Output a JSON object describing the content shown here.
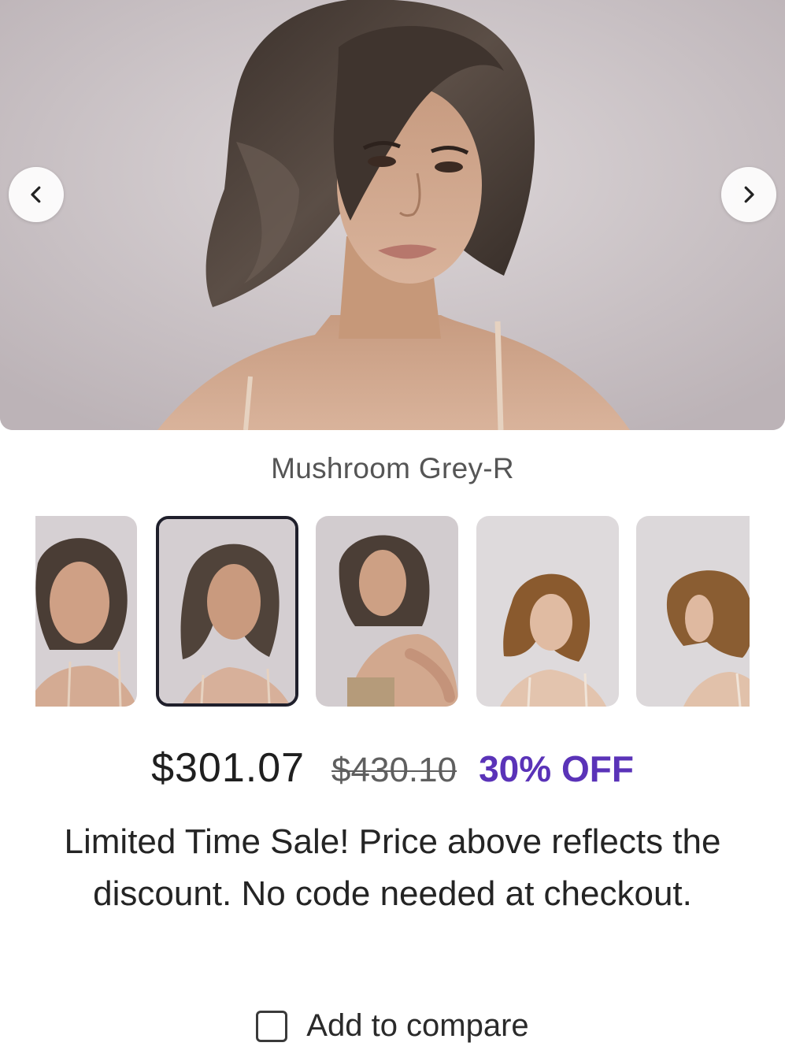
{
  "gallery": {
    "main_image_alt": "Model wearing Mushroom Grey-R wavy bob wig",
    "caption": "Mushroom Grey-R",
    "prev_icon": "chevron-left-icon",
    "next_icon": "chevron-right-icon",
    "thumbnails": [
      {
        "alt": "Mushroom Grey-R front view",
        "hair_color": "#4a3d35",
        "selected": false
      },
      {
        "alt": "Mushroom Grey-R side swept view",
        "hair_color": "#50433a",
        "selected": true
      },
      {
        "alt": "Mushroom Grey-R shoulder pose",
        "hair_color": "#4b3e36",
        "selected": false
      },
      {
        "alt": "Brown bob wig front view",
        "hair_color": "#8a5a2e",
        "selected": false
      },
      {
        "alt": "Brown bob wig profile view",
        "hair_color": "#8a5d32",
        "selected": false
      }
    ]
  },
  "pricing": {
    "current": "$301.07",
    "original": "$430.10",
    "discount": "30% OFF",
    "discount_color": "#5a33b8",
    "notice": "Limited Time Sale! Price above reflects the discount. No code needed at checkout."
  },
  "compare": {
    "label": "Add to compare",
    "checked": false
  }
}
